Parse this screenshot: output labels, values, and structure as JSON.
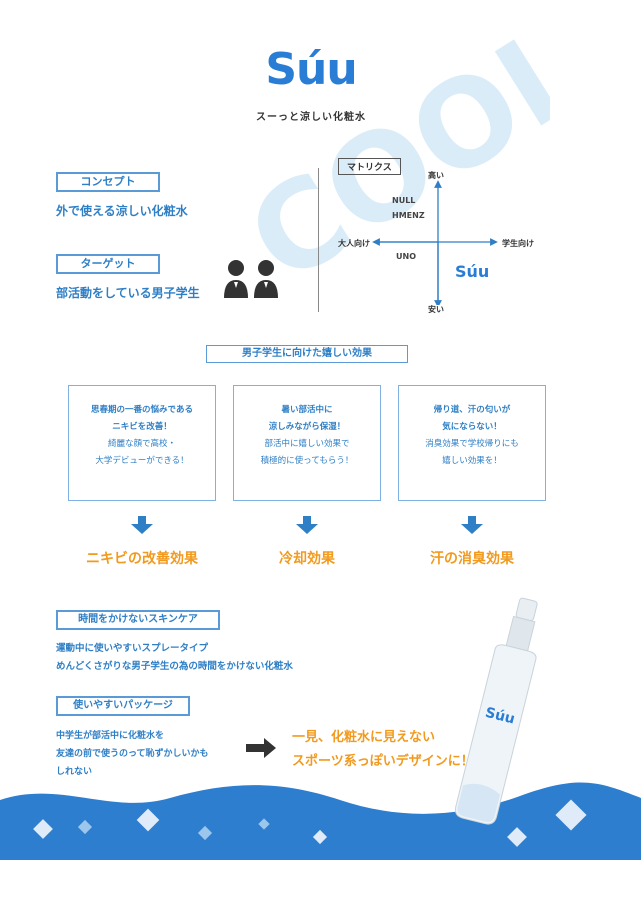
{
  "brand": {
    "logo": "Súu",
    "tagline": "スーっと涼しい化粧水",
    "watermark": "COOL"
  },
  "concept": {
    "label": "コンセプト",
    "text": "外で使える涼しい化粧水"
  },
  "target": {
    "label": "ターゲット",
    "text": "部活動をしている男子学生"
  },
  "matrix": {
    "label": "マトリクス",
    "top": "高い",
    "bottom": "安い",
    "left": "大人向け",
    "right": "学生向け",
    "competitor1": "NULL",
    "competitor2": "HMENZ",
    "competitor3": "UNO",
    "brand": "Súu"
  },
  "benefits": {
    "header": "男子学生に向けた嬉しい効果",
    "cards": [
      {
        "lines": [
          "思春期の一番の悩みである",
          "ニキビを改善！",
          "綺麗な顔で高校・",
          "大学デビューができる！"
        ],
        "bold": [
          true,
          true,
          false,
          false
        ],
        "effect": "ニキビの改善効果"
      },
      {
        "lines": [
          "暑い部活中に",
          "涼しみながら保湿！",
          "部活中に嬉しい効果で",
          "積極的に使ってもらう！"
        ],
        "bold": [
          true,
          true,
          false,
          false
        ],
        "effect": "冷却効果"
      },
      {
        "lines": [
          "帰り道、汗の匂いが",
          "気にならない！",
          "消臭効果で学校帰りにも",
          "嬉しい効果を！"
        ],
        "bold": [
          true,
          true,
          false,
          false
        ],
        "effect": "汗の消臭効果"
      }
    ]
  },
  "skincare": {
    "label": "時間をかけないスキンケア",
    "lines": [
      "運動中に使いやすいスプレータイプ",
      "めんどくさがりな男子学生の為の時間をかけない化粧水"
    ]
  },
  "package": {
    "label": "使いやすいパッケージ",
    "lines": [
      "中学生が部活中に化粧水を",
      "友達の前で使うのって恥ずかしいかも",
      "しれない"
    ],
    "result": [
      "一見、化粧水に見えない",
      "スポーツ系っぽいデザインに！"
    ]
  },
  "colors": {
    "primary": "#2f7fc6",
    "accent": "#f29a1e",
    "wave": "#2e7ed0"
  }
}
